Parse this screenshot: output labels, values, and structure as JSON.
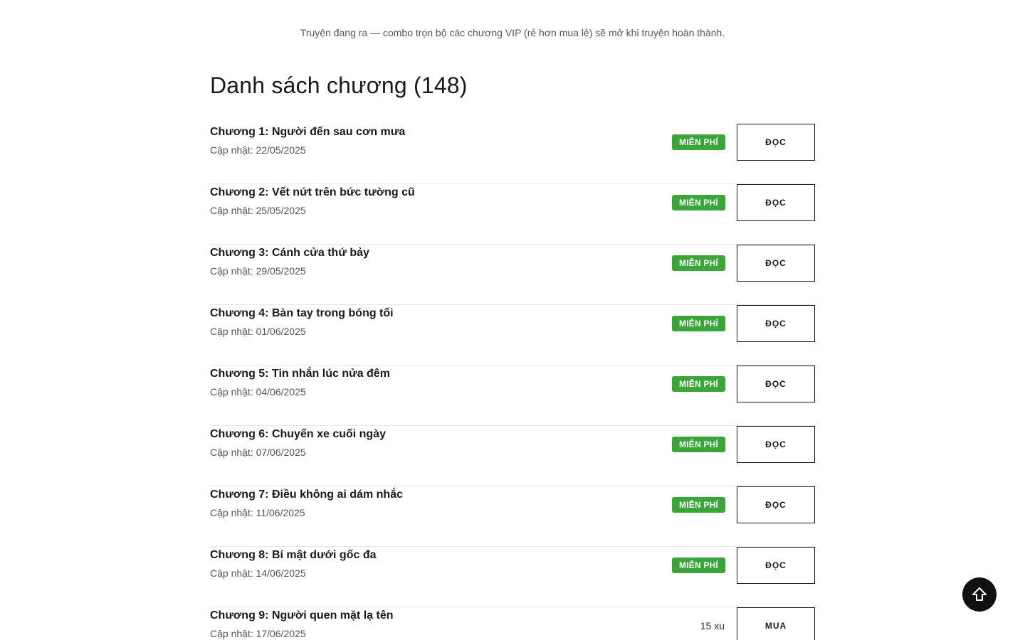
{
  "notice": "Truyện đang ra — combo trọn bộ các chương VIP (rẻ hơn mua lẻ) sẽ mở khi truyện hoàn thành.",
  "chapter_list": {
    "title": "Danh sách chương (148)",
    "chapters": [
      {
        "title": "Chương 1: Người đến sau cơn mưa",
        "date": "Cập nhật: 22/05/2025",
        "badge": "MIỄN PHÍ",
        "action": "ĐỌC"
      },
      {
        "title": "Chương 2: Vết nứt trên bức tường cũ",
        "date": "Cập nhật: 25/05/2025",
        "badge": "MIỄN PHÍ",
        "action": "ĐỌC"
      },
      {
        "title": "Chương 3: Cánh cửa thứ bảy",
        "date": "Cập nhật: 29/05/2025",
        "badge": "MIỄN PHÍ",
        "action": "ĐỌC"
      },
      {
        "title": "Chương 4: Bàn tay trong bóng tối",
        "date": "Cập nhật: 01/06/2025",
        "badge": "MIỄN PHÍ",
        "action": "ĐỌC"
      },
      {
        "title": "Chương 5: Tin nhắn lúc nửa đêm",
        "date": "Cập nhật: 04/06/2025",
        "badge": "MIỄN PHÍ",
        "action": "ĐỌC"
      },
      {
        "title": "Chương 6: Chuyến xe cuối ngày",
        "date": "Cập nhật: 07/06/2025",
        "badge": "MIỄN PHÍ",
        "action": "ĐỌC"
      },
      {
        "title": "Chương 7: Điều không ai dám nhắc",
        "date": "Cập nhật: 11/06/2025",
        "badge": "MIỄN PHÍ",
        "action": "ĐỌC"
      },
      {
        "title": "Chương 8: Bí mật dưới gốc đa",
        "date": "Cập nhật: 14/06/2025",
        "badge": "MIỄN PHÍ",
        "action": "ĐỌC"
      },
      {
        "title": "Chương 9: Người quen mặt lạ tên",
        "date": "Cập nhật: 17/06/2025",
        "price": "15 xu",
        "action": "MUA"
      }
    ]
  },
  "scroll_top_icon": "arrow-up-icon",
  "colors": {
    "free_badge": "#3aa63a",
    "scroll_top_bg": "#111111",
    "text": "#1a1a1a",
    "muted": "#555555"
  }
}
